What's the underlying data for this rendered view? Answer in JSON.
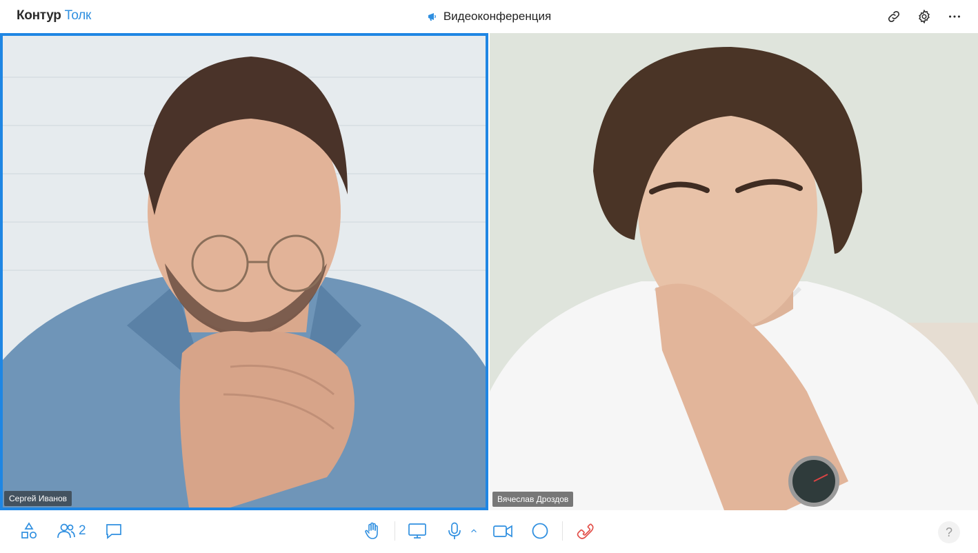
{
  "app": {
    "brand": "Контур",
    "product": "Толк"
  },
  "header": {
    "title": "Видеоконференция",
    "icons": [
      "megaphone-icon",
      "link-icon",
      "gear-icon",
      "more-icon"
    ]
  },
  "participants": [
    {
      "name": "Сергей Иванов",
      "active": true
    },
    {
      "name": "Вячеслав Дроздов",
      "active": false
    }
  ],
  "toolbar": {
    "participants_count": "2",
    "help_label": "?",
    "left": [
      "shapes-icon",
      "people-icon",
      "chat-icon"
    ],
    "center": [
      "hand-icon",
      "screen-share-icon",
      "microphone-icon",
      "chevron-up-icon",
      "camera-icon",
      "record-icon",
      "hangup-icon"
    ]
  },
  "colors": {
    "accent": "#2f8fe0",
    "active_border": "#1f86e3",
    "hangup": "#e2504a"
  }
}
